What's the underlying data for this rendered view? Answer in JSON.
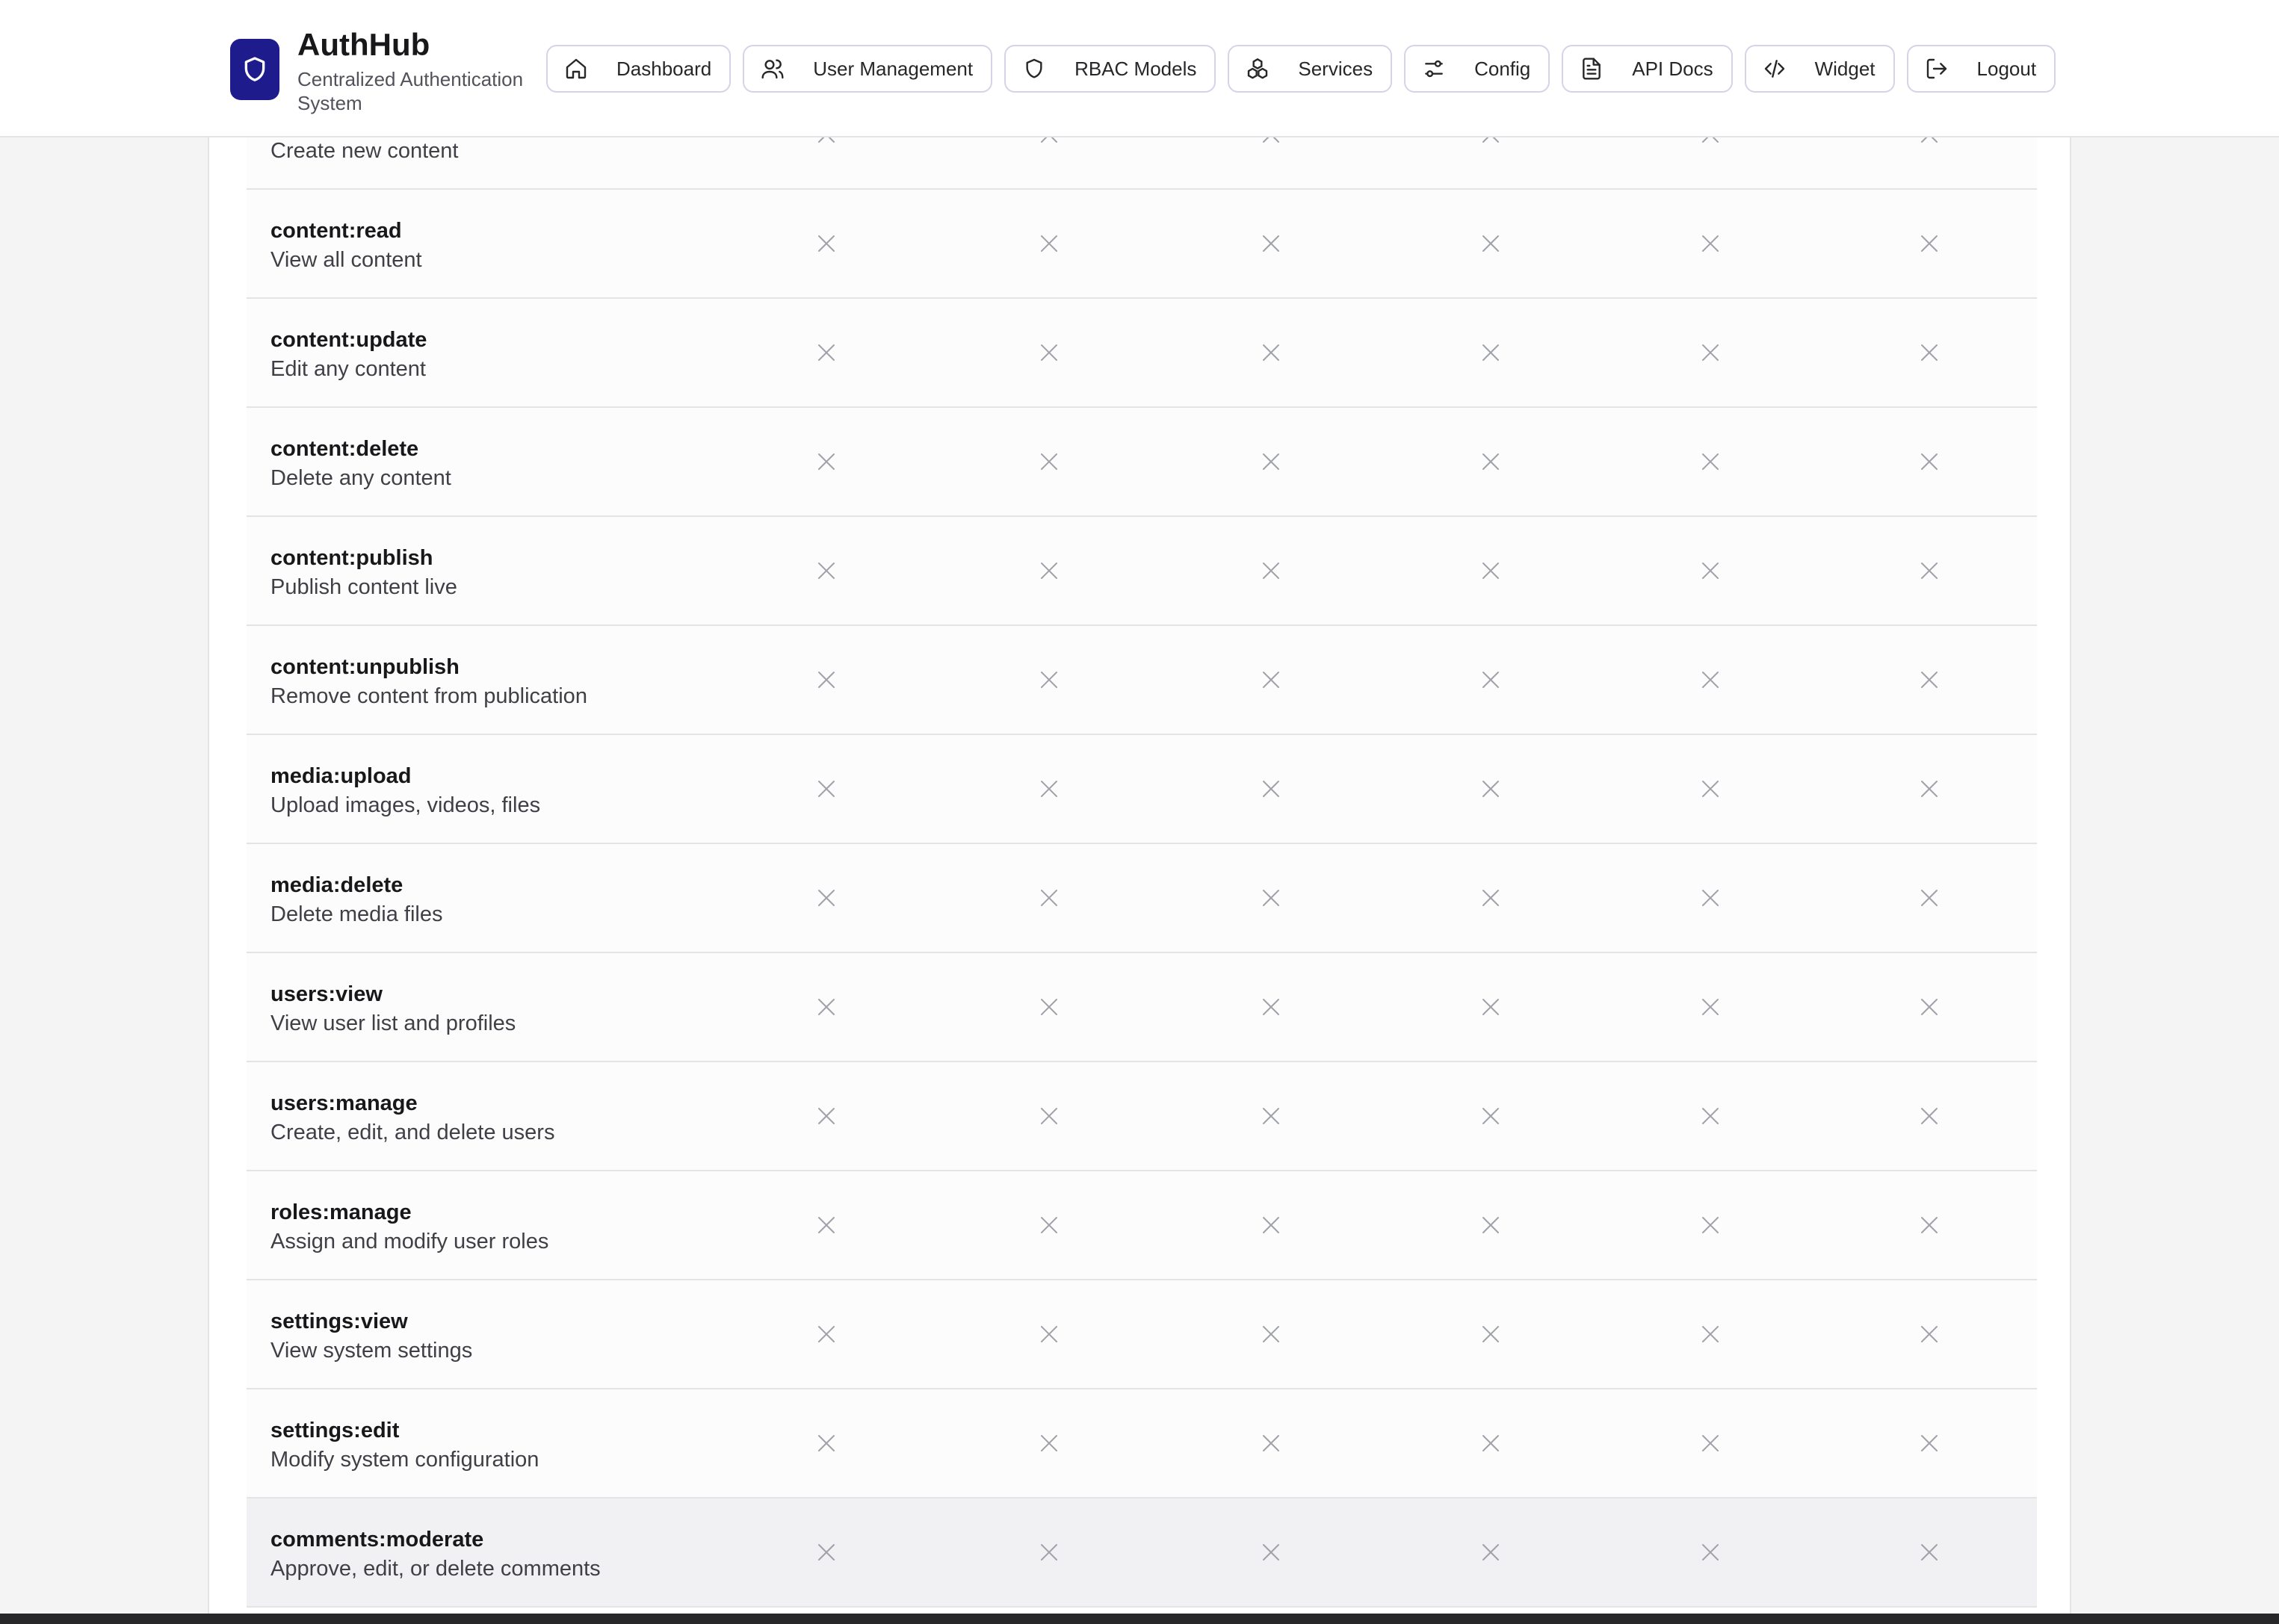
{
  "app": {
    "title": "AuthHub",
    "subtitle": "Centralized Authentication System",
    "logo_icon": "shield-icon",
    "accent": "#1e1b8c"
  },
  "nav": [
    {
      "label": "Dashboard",
      "icon": "home-icon"
    },
    {
      "label": "User Management",
      "icon": "users-icon"
    },
    {
      "label": "RBAC Models",
      "icon": "shield-icon"
    },
    {
      "label": "Services",
      "icon": "services-icon"
    },
    {
      "label": "Config",
      "icon": "sliders-icon"
    },
    {
      "label": "API Docs",
      "icon": "document-icon"
    },
    {
      "label": "Widget",
      "icon": "code-icon"
    },
    {
      "label": "Logout",
      "icon": "logout-icon"
    }
  ],
  "permissions": [
    {
      "name": "",
      "description": "Create new content",
      "granted": [
        false,
        false,
        false,
        false,
        false,
        false
      ]
    },
    {
      "name": "content:read",
      "description": "View all content",
      "granted": [
        false,
        false,
        false,
        false,
        false,
        false
      ]
    },
    {
      "name": "content:update",
      "description": "Edit any content",
      "granted": [
        false,
        false,
        false,
        false,
        false,
        false
      ]
    },
    {
      "name": "content:delete",
      "description": "Delete any content",
      "granted": [
        false,
        false,
        false,
        false,
        false,
        false
      ]
    },
    {
      "name": "content:publish",
      "description": "Publish content live",
      "granted": [
        false,
        false,
        false,
        false,
        false,
        false
      ]
    },
    {
      "name": "content:unpublish",
      "description": "Remove content from publication",
      "granted": [
        false,
        false,
        false,
        false,
        false,
        false
      ]
    },
    {
      "name": "media:upload",
      "description": "Upload images, videos, files",
      "granted": [
        false,
        false,
        false,
        false,
        false,
        false
      ]
    },
    {
      "name": "media:delete",
      "description": "Delete media files",
      "granted": [
        false,
        false,
        false,
        false,
        false,
        false
      ]
    },
    {
      "name": "users:view",
      "description": "View user list and profiles",
      "granted": [
        false,
        false,
        false,
        false,
        false,
        false
      ]
    },
    {
      "name": "users:manage",
      "description": "Create, edit, and delete users",
      "granted": [
        false,
        false,
        false,
        false,
        false,
        false
      ]
    },
    {
      "name": "roles:manage",
      "description": "Assign and modify user roles",
      "granted": [
        false,
        false,
        false,
        false,
        false,
        false
      ]
    },
    {
      "name": "settings:view",
      "description": "View system settings",
      "granted": [
        false,
        false,
        false,
        false,
        false,
        false
      ]
    },
    {
      "name": "settings:edit",
      "description": "Modify system configuration",
      "granted": [
        false,
        false,
        false,
        false,
        false,
        false
      ]
    },
    {
      "name": "comments:moderate",
      "description": "Approve, edit, or delete comments",
      "granted": [
        false,
        false,
        false,
        false,
        false,
        false
      ]
    }
  ],
  "cell_icon": "x-icon",
  "colors": {
    "x_mark": "#a1a1aa",
    "highlight_row": "#f1f1f3"
  }
}
